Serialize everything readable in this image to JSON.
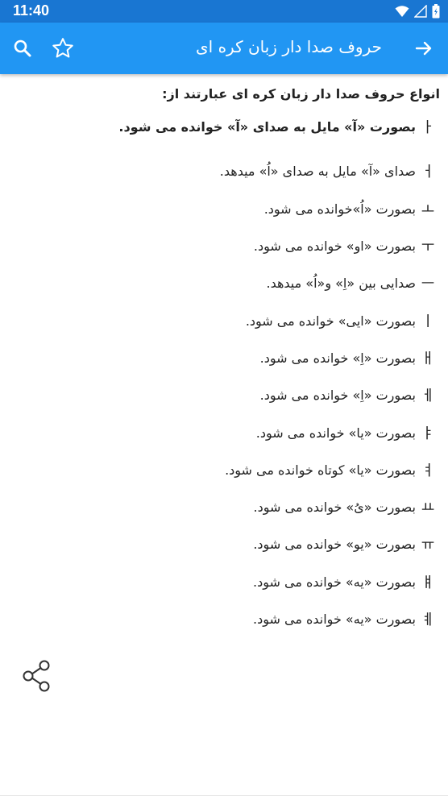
{
  "status": {
    "time": "11:40"
  },
  "appbar": {
    "title": "حروف صدا دار زبان کره ای"
  },
  "content": {
    "intro": "انواع حروف صدا دار زبان کره ای عبارتند از:",
    "rows": [
      {
        "symbol": "ㅏ",
        "text": "بصورت «آ» مایل به صدای «آ» خوانده می شود."
      },
      {
        "symbol": "ㅓ",
        "text": "صدای «آ» مایل به صدای «اُ» میدهد."
      },
      {
        "symbol": "ㅗ",
        "text": "بصورت «اُ»خوانده می شود."
      },
      {
        "symbol": "ㅜ",
        "text": "بصورت «او» خوانده می شود."
      },
      {
        "symbol": "ㅡ",
        "text": "صدایی بین «اِ» و«اُ» میدهد."
      },
      {
        "symbol": "ㅣ",
        "text": "بصورت «ایی» خوانده می شود."
      },
      {
        "symbol": "ㅐ",
        "text": "بصورت «اِ» خوانده می شود."
      },
      {
        "symbol": "ㅔ",
        "text": "بصورت «اِ» خوانده می شود."
      },
      {
        "symbol": "ㅑ",
        "text": "بصورت «یا» خوانده می شود."
      },
      {
        "symbol": "ㅕ",
        "text": "بصورت «یا» کوتاه خوانده می شود."
      },
      {
        "symbol": "ㅛ",
        "text": "بصورت «یُ» خوانده می شود."
      },
      {
        "symbol": "ㅠ",
        "text": "بصورت «یو» خوانده می شود."
      },
      {
        "symbol": "ㅒ",
        "text": "بصورت «یه» خوانده می شود."
      },
      {
        "symbol": "ㅖ",
        "text": "بصورت «یه» خوانده می شود."
      }
    ]
  },
  "icons": {
    "back": "arrow-forward-icon",
    "star": "star-outline-icon",
    "search": "search-icon",
    "share": "share-icon",
    "wifi": "wifi-icon",
    "signal": "signal-icon",
    "battery": "battery-icon"
  },
  "colors": {
    "appbar": "#2196f3",
    "statusbar": "#1976d2",
    "text": "#222222"
  }
}
